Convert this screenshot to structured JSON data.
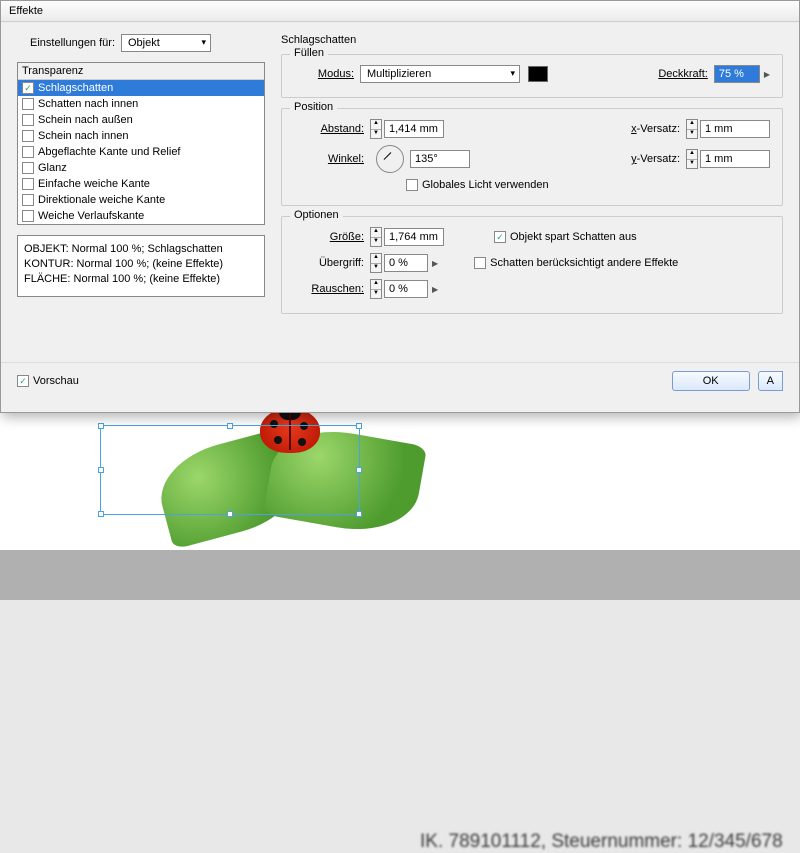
{
  "dialog": {
    "title": "Effekte"
  },
  "settings": {
    "label": "Einstellungen für:",
    "value": "Objekt"
  },
  "effects_list": {
    "header": "Transparenz",
    "items": [
      {
        "label": "Schlagschatten",
        "checked": true,
        "selected": true
      },
      {
        "label": "Schatten nach innen",
        "checked": false
      },
      {
        "label": "Schein nach außen",
        "checked": false
      },
      {
        "label": "Schein nach innen",
        "checked": false
      },
      {
        "label": "Abgeflachte Kante und Relief",
        "checked": false
      },
      {
        "label": "Glanz",
        "checked": false
      },
      {
        "label": "Einfache weiche Kante",
        "checked": false
      },
      {
        "label": "Direktionale weiche Kante",
        "checked": false
      },
      {
        "label": "Weiche Verlaufskante",
        "checked": false
      }
    ]
  },
  "summary": {
    "line1": "OBJEKT: Normal 100 %; Schlagschatten",
    "line2": "KONTUR: Normal 100 %; (keine Effekte)",
    "line3": "FLÄCHE: Normal 100 %; (keine Effekte)"
  },
  "panel_title": "Schlagschatten",
  "fill": {
    "group": "Füllen",
    "mode_label": "Modus:",
    "mode_value": "Multiplizieren",
    "opacity_label": "Deckkraft:",
    "opacity_value": "75 %"
  },
  "position": {
    "group": "Position",
    "distance_label": "Abstand:",
    "distance_value": "1,414 mm",
    "angle_label": "Winkel:",
    "angle_value": "135°",
    "xoffset_label": "x-Versatz:",
    "xoffset_value": "1 mm",
    "yoffset_label": "y-Versatz:",
    "yoffset_value": "1 mm",
    "global_light": "Globales Licht verwenden"
  },
  "options": {
    "group": "Optionen",
    "size_label": "Größe:",
    "size_value": "1,764 mm",
    "spread_label": "Übergriff:",
    "spread_value": "0 %",
    "noise_label": "Rauschen:",
    "noise_value": "0 %",
    "knockout": "Objekt spart Schatten aus",
    "honors": "Schatten berücksichtigt andere Effekte"
  },
  "preview_label": "Vorschau",
  "ok_label": "OK",
  "bg_text": "IK. 789101112, Steuernummer: 12/345/678"
}
